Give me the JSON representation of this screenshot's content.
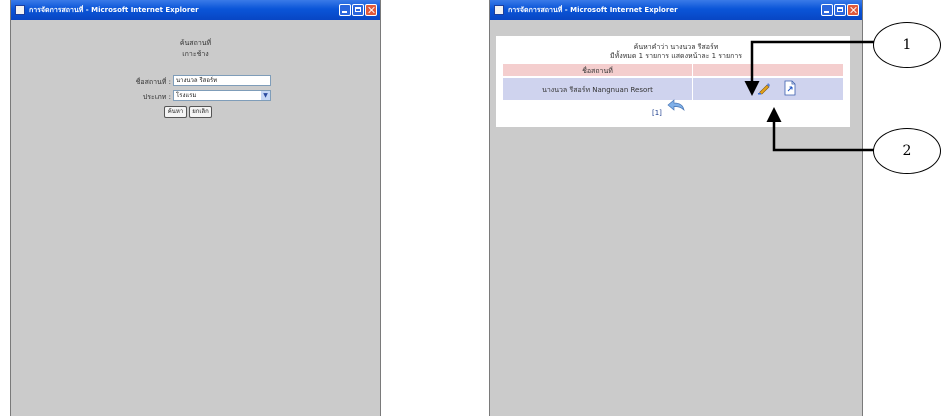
{
  "windows": [
    {
      "title": "การจัดการสถานที่ - Microsoft Internet Explorer",
      "heading_line1": "ค้นสถานที่",
      "heading_line2": "เกาะช้าง",
      "place_name_label": "ชื่อสถานที่ :",
      "place_name_value": "นางนวล รีสอร์ท",
      "type_label": "ประเภท :",
      "type_value": "โรงแรม",
      "search_button": "ค้นหา",
      "cancel_button": "ยกเลิก"
    },
    {
      "title": "การจัดการสถานที่ - Microsoft Internet Explorer",
      "result_line1": "ค้นหาคำว่า นางนวล รีสอร์ท",
      "result_line2": "มีทั้งหมด 1 รายการ แสดงหน้าละ 1 รายการ",
      "column_header": "ชื่อสถานที่",
      "row_name": "นางนวล รีสอร์ท  Nangnuan Resort",
      "pagination": "[1]"
    }
  ],
  "callouts": [
    "1",
    "2"
  ],
  "icons": {
    "edit": "edit-icon",
    "detail": "document-icon",
    "back": "back-arrow-icon"
  },
  "colors": {
    "title_bar": "#0a55d8",
    "window_bg": "#cbcbcb",
    "table_header": "#f4cece",
    "table_row": "#cfd3ee"
  }
}
